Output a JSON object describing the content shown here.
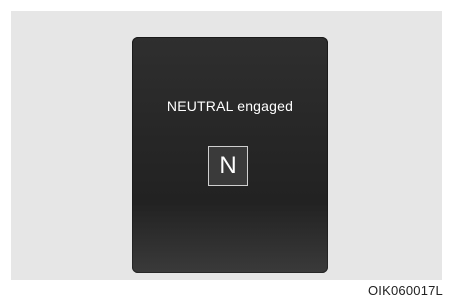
{
  "display": {
    "message": "NEUTRAL engaged",
    "gear_indicator": "N"
  },
  "figure_code": "OIK060017L",
  "colors": {
    "display_background": "#2a2a2a",
    "panel_background": "#e6e6e6",
    "text": "#ffffff"
  }
}
